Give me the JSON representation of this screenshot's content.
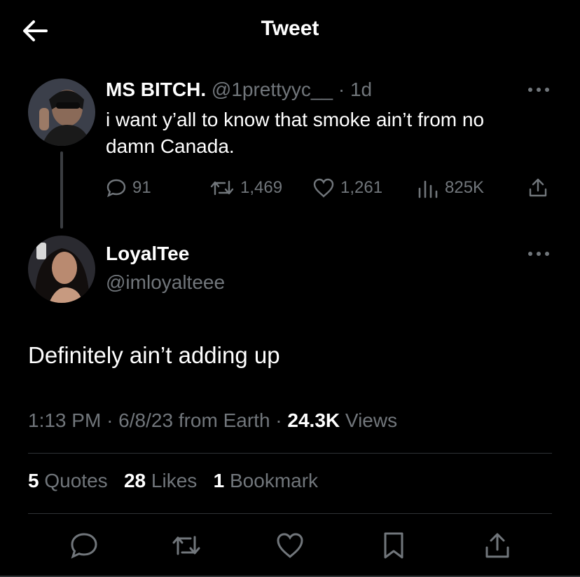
{
  "header": {
    "title": "Tweet"
  },
  "quoted_tweet": {
    "display_name": "MS BITCH.",
    "handle": "@1prettyyc__",
    "separator": "·",
    "age": "1d",
    "text_line1": "i want y’all to know that smoke ain’t from no",
    "text_line2": "damn Canada.",
    "replies": "91",
    "retweets": "1,469",
    "likes": "1,261",
    "views": "825K"
  },
  "main_tweet": {
    "display_name": "LoyalTee",
    "handle": "@imloyalteee",
    "text": "Definitely ain’t adding up",
    "time": "1:13 PM",
    "date": "6/8/23",
    "source": "from Earth",
    "views_count": "24.3K",
    "views_label": "Views",
    "quotes_count": "5",
    "quotes_label": "Quotes",
    "likes_count": "28",
    "likes_label": "Likes",
    "bookmarks_count": "1",
    "bookmarks_label": "Bookmark"
  },
  "colors": {
    "background": "#000000",
    "text": "#e7e9ea",
    "muted": "#71767b",
    "divider": "#2f3336"
  },
  "icons": [
    "back-arrow-icon",
    "more-icon",
    "reply-icon",
    "retweet-icon",
    "like-icon",
    "views-icon",
    "share-icon",
    "bookmark-icon"
  ]
}
